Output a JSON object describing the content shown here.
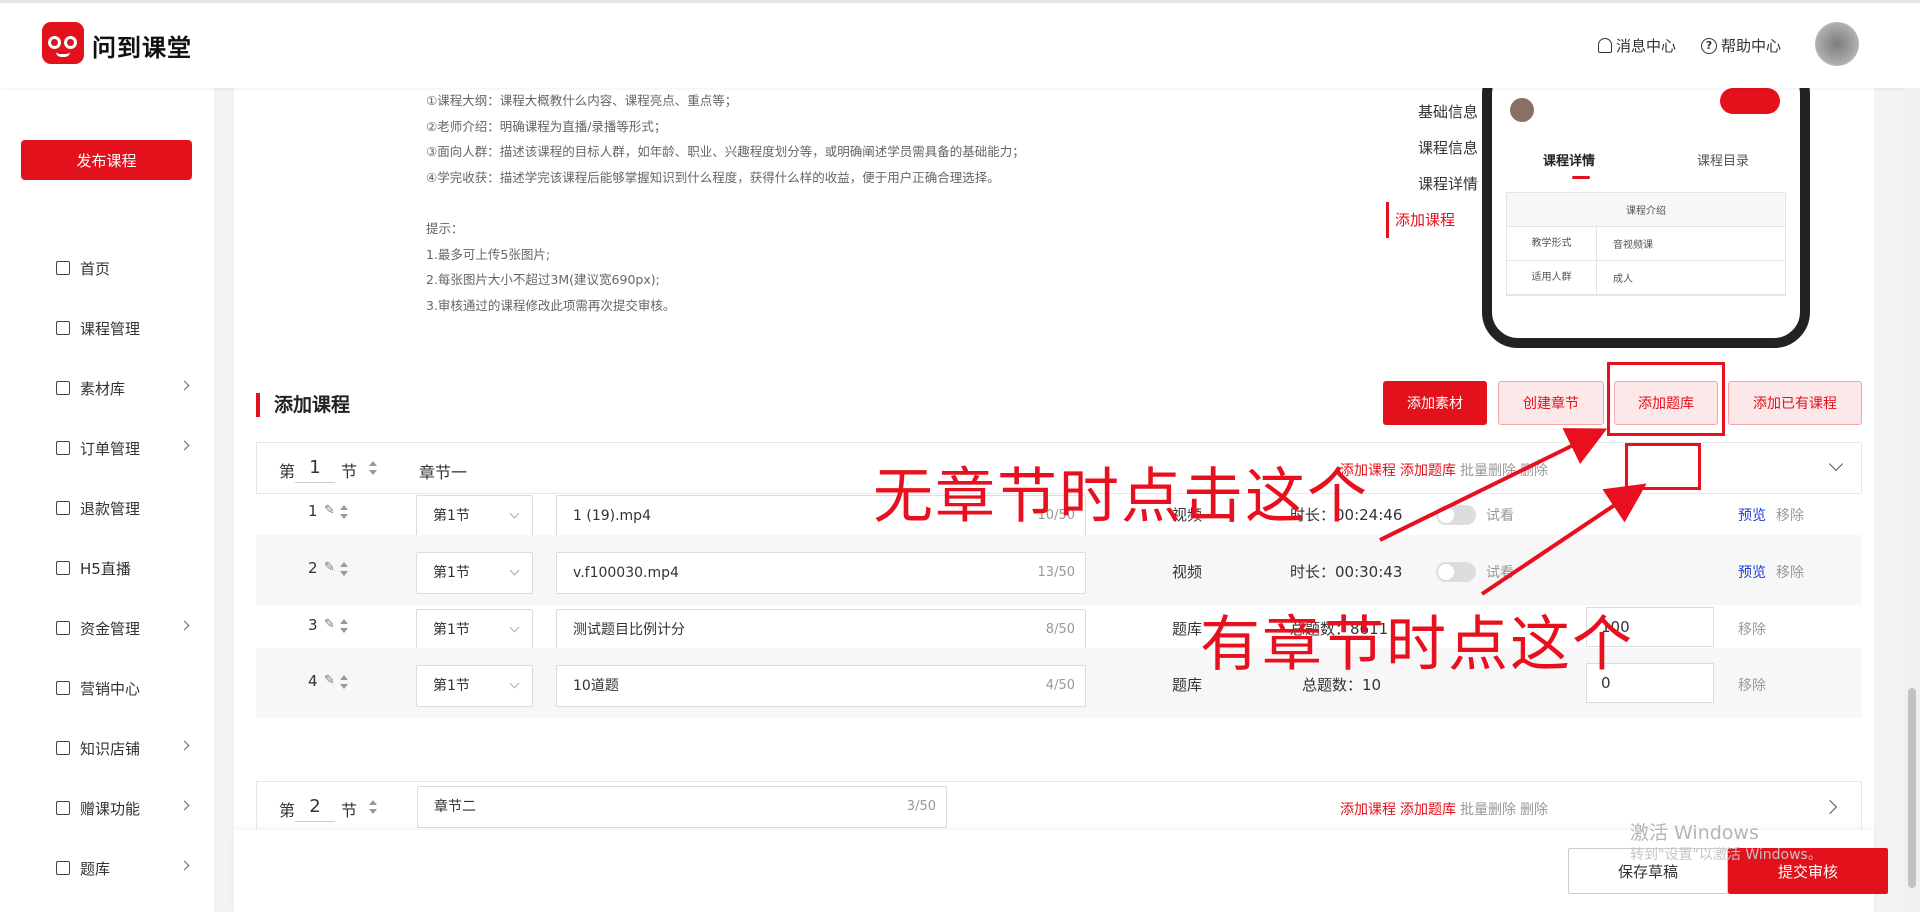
{
  "header": {
    "brand": "问到课堂",
    "messages": "消息中心",
    "help": "帮助中心"
  },
  "sidebar": {
    "publish": "发布课程",
    "items": [
      {
        "label": "首页",
        "icon": "home-icon",
        "chevron": false
      },
      {
        "label": "课程管理",
        "icon": "course-icon",
        "chevron": false
      },
      {
        "label": "素材库",
        "icon": "folder-icon",
        "chevron": true
      },
      {
        "label": "订单管理",
        "icon": "order-icon",
        "chevron": true
      },
      {
        "label": "退款管理",
        "icon": "refund-icon",
        "chevron": false
      },
      {
        "label": "H5直播",
        "icon": "live-icon",
        "chevron": false
      },
      {
        "label": "资金管理",
        "icon": "wallet-icon",
        "chevron": true
      },
      {
        "label": "营销中心",
        "icon": "gift-icon",
        "chevron": false
      },
      {
        "label": "知识店铺",
        "icon": "shop-icon",
        "chevron": true
      },
      {
        "label": "赠课功能",
        "icon": "present-icon",
        "chevron": true
      },
      {
        "label": "题库",
        "icon": "quiz-icon",
        "chevron": true
      }
    ]
  },
  "description": {
    "lines": [
      "①课程大纲：课程大概教什么内容、课程亮点、重点等；",
      "②老师介绍：明确课程为直播/录播等形式；",
      "③面向人群：描述该课程的目标人群，如年龄、职业、兴趣程度划分等，或明确阐述学员需具备的基础能力；",
      "④学完收获：描述学完该课程后能够掌握知识到什么程度，获得什么样的收益，便于用户正确合理选择。",
      "",
      "提示：",
      "1.最多可上传5张图片;",
      "2.每张图片大小不超过3M(建议宽690px);",
      "3.审核通过的课程修改此项需再次提交审核。"
    ]
  },
  "anchor_nav": {
    "items": [
      "基础信息",
      "课程信息",
      "课程详情",
      "添加课程"
    ],
    "active": "添加课程"
  },
  "phone_preview": {
    "tab_detail": "课程详情",
    "tab_catalog": "课程目录",
    "table_head": "课程介绍",
    "rows": [
      {
        "k": "教学形式",
        "v": "音视频课"
      },
      {
        "k": "适用人群",
        "v": "成人"
      }
    ]
  },
  "section": {
    "title": "添加课程",
    "buttons": {
      "add_material": "添加素材",
      "create_chapter": "创建章节",
      "add_quiz": "添加题库",
      "add_existing": "添加已有课程"
    }
  },
  "chapters": [
    {
      "prefix": "第",
      "num": "1",
      "suffix": "节",
      "name": "章节一",
      "actions": {
        "add_course": "添加课程",
        "add_quiz": "添加题库",
        "batch_delete": "批量删除",
        "delete": "删除"
      }
    },
    {
      "prefix": "第",
      "num": "2",
      "suffix": "节",
      "name": "章节二",
      "count": "3/50",
      "actions": {
        "add_course": "添加课程",
        "add_quiz": "添加题库",
        "batch_delete": "批量删除",
        "delete": "删除"
      }
    }
  ],
  "lessons": [
    {
      "idx": "1",
      "section": "第1节",
      "title": "1 (19).mp4",
      "count": "10/50",
      "type": "视频",
      "meta": "时长：00:24:46",
      "try": "试看",
      "preview": "预览",
      "remove": "移除"
    },
    {
      "idx": "2",
      "section": "第1节",
      "title": "v.f100030.mp4",
      "count": "13/50",
      "type": "视频",
      "meta": "时长：00:30:43",
      "try": "试看",
      "preview": "预览",
      "remove": "移除"
    },
    {
      "idx": "3",
      "section": "第1节",
      "title": "测试题目比例计分",
      "count": "8/50",
      "type": "题库",
      "meta": "总题数：8611",
      "score": "100",
      "remove": "移除"
    },
    {
      "idx": "4",
      "section": "第1节",
      "title": "10道题",
      "count": "4/50",
      "type": "题库",
      "meta": "总题数：10",
      "score": "0",
      "remove": "移除"
    }
  ],
  "footer": {
    "save_draft": "保存草稿",
    "submit": "提交审核"
  },
  "watermark": {
    "line1": "激活 Windows",
    "line2": "转到\"设置\"以激活 Windows。"
  },
  "annotations": {
    "no_chapter": "无章节时点击这个",
    "has_chapter": "有章节时点这个"
  },
  "colors": {
    "accent": "#e3111b",
    "annotation": "#e8101f",
    "link_blue": "#1d3fd6"
  }
}
